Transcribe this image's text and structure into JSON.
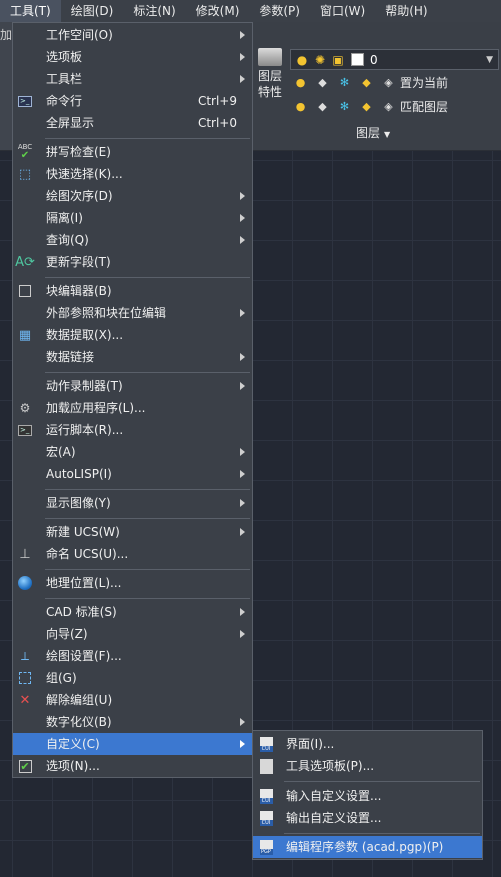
{
  "menubar": {
    "items": [
      {
        "label": "工具(T)",
        "active": true
      },
      {
        "label": "绘图(D)"
      },
      {
        "label": "标注(N)"
      },
      {
        "label": "修改(M)"
      },
      {
        "label": "参数(P)"
      },
      {
        "label": "窗口(W)"
      },
      {
        "label": "帮助(H)"
      }
    ]
  },
  "ribbon": {
    "left_fragment": "加",
    "layer_properties_label_1": "图层",
    "layer_properties_label_2": "特性",
    "layer_combo_value": "0",
    "set_current_label": "置为当前",
    "match_layer_label": "匹配图层",
    "panel_title": "图层"
  },
  "menu": {
    "items": [
      {
        "label": "工作空间(O)",
        "has_submenu": true,
        "icon": ""
      },
      {
        "label": "选项板",
        "has_submenu": true,
        "icon": ""
      },
      {
        "label": "工具栏",
        "has_submenu": true,
        "icon": ""
      },
      {
        "label": "命令行",
        "shortcut": "Ctrl+9",
        "icon": "command-line-icon"
      },
      {
        "label": "全屏显示",
        "shortcut": "Ctrl+0",
        "icon": ""
      },
      {
        "label": "拼写检查(E)",
        "icon": "spell-check-icon"
      },
      {
        "label": "快速选择(K)...",
        "icon": "quick-select-icon"
      },
      {
        "label": "绘图次序(D)",
        "has_submenu": true,
        "icon": ""
      },
      {
        "label": "隔离(I)",
        "has_submenu": true,
        "icon": ""
      },
      {
        "label": "查询(Q)",
        "has_submenu": true,
        "icon": ""
      },
      {
        "label": "更新字段(T)",
        "icon": "update-field-icon"
      },
      {
        "label": "块编辑器(B)",
        "icon": "block-editor-icon"
      },
      {
        "label": "外部参照和块在位编辑",
        "has_submenu": true,
        "icon": ""
      },
      {
        "label": "数据提取(X)...",
        "icon": "data-extraction-icon"
      },
      {
        "label": "数据链接",
        "has_submenu": true,
        "icon": ""
      },
      {
        "label": "动作录制器(T)",
        "has_submenu": true,
        "icon": ""
      },
      {
        "label": "加载应用程序(L)...",
        "icon": "load-application-icon"
      },
      {
        "label": "运行脚本(R)...",
        "icon": "run-script-icon"
      },
      {
        "label": "宏(A)",
        "has_submenu": true,
        "icon": ""
      },
      {
        "label": "AutoLISP(I)",
        "has_submenu": true,
        "icon": ""
      },
      {
        "label": "显示图像(Y)",
        "has_submenu": true,
        "icon": ""
      },
      {
        "label": "新建 UCS(W)",
        "has_submenu": true,
        "icon": ""
      },
      {
        "label": "命名 UCS(U)...",
        "icon": "named-ucs-icon"
      },
      {
        "label": "地理位置(L)...",
        "icon": "globe-icon"
      },
      {
        "label": "CAD 标准(S)",
        "has_submenu": true,
        "icon": ""
      },
      {
        "label": "向导(Z)",
        "has_submenu": true,
        "icon": ""
      },
      {
        "label": "绘图设置(F)...",
        "icon": "drafting-settings-icon"
      },
      {
        "label": "组(G)",
        "icon": "group-icon"
      },
      {
        "label": "解除编组(U)",
        "icon": "ungroup-icon"
      },
      {
        "label": "数字化仪(B)",
        "has_submenu": true,
        "icon": ""
      },
      {
        "label": "自定义(C)",
        "has_submenu": true,
        "highlighted": true,
        "icon": ""
      },
      {
        "label": "选项(N)...",
        "icon": "options-icon"
      }
    ]
  },
  "submenu": {
    "items": [
      {
        "label": "界面(I)...",
        "icon_text": "CUI"
      },
      {
        "label": "工具选项板(P)...",
        "icon_text": ""
      },
      {
        "label": "输入自定义设置...",
        "icon_text": "CUI"
      },
      {
        "label": "输出自定义设置...",
        "icon_text": "CUI"
      },
      {
        "label": "编辑程序参数 (acad.pgp)(P)",
        "icon_text": "PGP",
        "highlighted": true
      }
    ]
  },
  "colors": {
    "menu_bg": "#3b4048",
    "highlight": "#3c78d0",
    "canvas": "#232833"
  }
}
